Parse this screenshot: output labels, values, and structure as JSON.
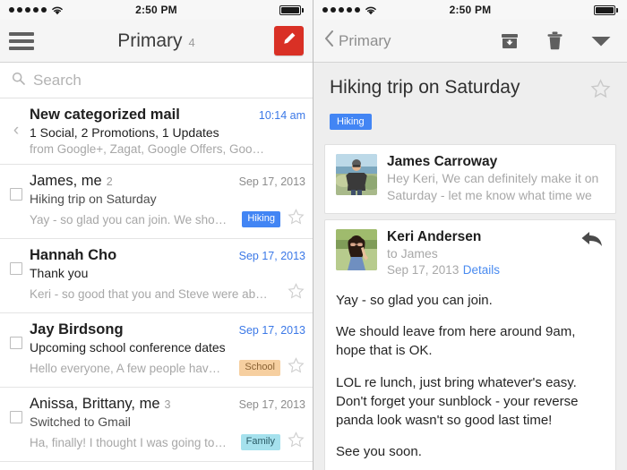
{
  "statusbar": {
    "signal_dots": 5,
    "wifi_icon": "wifi-icon",
    "time": "2:50 PM",
    "battery_icon": "battery-full-icon"
  },
  "left": {
    "navbar": {
      "menu_icon": "hamburger-menu-icon",
      "title": "Primary",
      "count": "4",
      "compose_icon": "compose-pencil-icon"
    },
    "search": {
      "icon": "search-icon",
      "placeholder": "Search"
    },
    "rows": [
      {
        "lead": "chevron-left",
        "sender": "New categorized mail",
        "unread": true,
        "count": "",
        "date": "10:14 am",
        "date_blue": true,
        "subject": "1 Social, 2 Promotions, 1 Updates",
        "snippet": "from Google+, Zagat, Google Offers, Goo…",
        "label": "",
        "label_bg": "",
        "label_fg": "",
        "star": false
      },
      {
        "lead": "checkbox",
        "sender": "James, me",
        "unread": false,
        "count": "2",
        "date": "Sep 17, 2013",
        "date_blue": false,
        "subject": "Hiking trip on Saturday",
        "snippet": "Yay - so glad you can join. We sho…",
        "label": "Hiking",
        "label_bg": "#4285f4",
        "label_fg": "#ffffff",
        "star": true
      },
      {
        "lead": "checkbox",
        "sender": "Hannah Cho",
        "unread": true,
        "count": "",
        "date": "Sep 17, 2013",
        "date_blue": true,
        "subject": "Thank you",
        "snippet": "Keri - so good that you and Steve were ab…",
        "label": "",
        "label_bg": "",
        "label_fg": "",
        "star": true
      },
      {
        "lead": "checkbox",
        "sender": "Jay Birdsong",
        "unread": true,
        "count": "",
        "date": "Sep 17, 2013",
        "date_blue": true,
        "subject": "Upcoming school conference dates",
        "snippet": "Hello everyone, A few people hav…",
        "label": "School",
        "label_bg": "#f6cfa0",
        "label_fg": "#8a6234",
        "star": true
      },
      {
        "lead": "checkbox",
        "sender": "Anissa, Brittany, me",
        "unread": false,
        "count": "3",
        "date": "Sep 17, 2013",
        "date_blue": false,
        "subject": "Switched to Gmail",
        "snippet": "Ha, finally! I thought I was going to…",
        "label": "Family",
        "label_bg": "#a5e1ed",
        "label_fg": "#2b5b66",
        "star": true
      }
    ]
  },
  "right": {
    "navbar": {
      "back_icon": "chevron-left-icon",
      "back_label": "Primary",
      "archive_icon": "archive-icon",
      "delete_icon": "trash-icon",
      "more_icon": "chevron-down-icon"
    },
    "thread": {
      "title": "Hiking trip on Saturday",
      "star_icon": "star-outline-icon",
      "label": "Hiking",
      "label_bg": "#4285f4",
      "label_fg": "#ffffff"
    },
    "messages": [
      {
        "avatar": "photo-man-beach",
        "sender": "James Carroway",
        "collapsed": true,
        "preview_line1": "Hey Keri, We can definitely make it on",
        "preview_line2": "Saturday - let me know what time we"
      },
      {
        "avatar": "photo-woman-sunglasses",
        "sender": "Keri Andersen",
        "collapsed": false,
        "to": "to James",
        "date": "Sep 17, 2013",
        "details_label": "Details",
        "reply_icon": "reply-arrow-icon",
        "body": [
          "Yay - so glad you can join.",
          "We should leave from here around 9am, hope that is OK.",
          "LOL re lunch, just bring whatever's easy. Don't forget your sunblock - your reverse panda look wasn't so good last time!",
          "See you soon."
        ]
      }
    ]
  }
}
